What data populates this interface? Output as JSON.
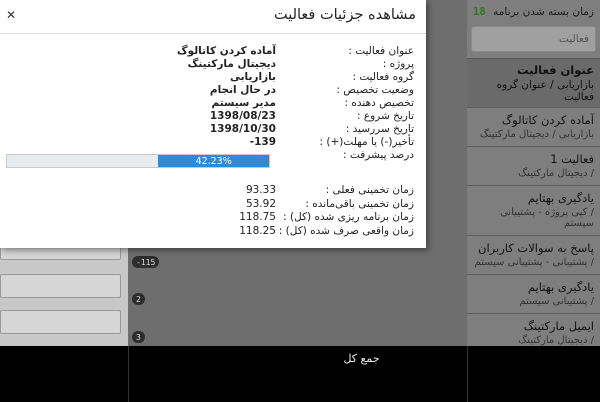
{
  "background": {
    "header_label": "زمان بسته شدن برنامه",
    "header_number": "18",
    "search_placeholder": "فعالیت",
    "column_header": {
      "title": "عنوان فعالیت",
      "subtitle": "بازاریابی / عنوان گروه فعالیت"
    },
    "items": [
      {
        "title": "آماده کردن کاتالوگ",
        "subtitle": "بازاریابی / دیجیتال مارکتینگ"
      },
      {
        "title": "فعالیت 1",
        "subtitle": "/ دیجیتال مارکتینگ"
      },
      {
        "title": "یادگیری بهتایم",
        "subtitle": "/ کپی پروژه - پشتیبانی سیستم"
      },
      {
        "title": "پاسخ به سوالات کاربران",
        "subtitle": "/ پشتیبانی - پشتیبانی سیستم"
      },
      {
        "title": "یادگیری بهتایم",
        "subtitle": "/ پشتیبانی سیستم"
      },
      {
        "title": "ایمیل مارکتینگ",
        "subtitle": "/ دیجیتال مارکتینگ"
      }
    ],
    "badges": [
      "-115",
      "2",
      "3"
    ],
    "total_label": "جمع کل"
  },
  "modal": {
    "title": "مشاهده جزئیات فعالیت",
    "close_symbol": "✕",
    "details": [
      {
        "label": "عنوان فعالیت :",
        "value": "آماده کردن کاتالوگ"
      },
      {
        "label": "پروژه :",
        "value": "دیجیتال مارکتینگ"
      },
      {
        "label": "گروه فعالیت :",
        "value": "بازاریابی"
      },
      {
        "label": "وضعیت تخصیص :",
        "value": "در حال انجام"
      },
      {
        "label": "تخصیص دهنده :",
        "value": "مدیر سیستم"
      },
      {
        "label": "تاریخ شروع :",
        "value": "1398/08/23"
      },
      {
        "label": "تاریخ سررسید :",
        "value": "1398/10/30"
      },
      {
        "label": "تأخیر(-) یا مهلت(+) :",
        "value": "-139"
      }
    ],
    "progress": {
      "label": "درصد پیشرفت :",
      "percent": 42.23,
      "text": "42.23%"
    },
    "times": [
      {
        "label": "زمان تخمینی فعلی :",
        "value": "93.33"
      },
      {
        "label": "زمان تخمینی باقی‌مانده :",
        "value": "53.92"
      },
      {
        "label": "زمان برنامه ریزی شده (کل) :",
        "value": "118.75"
      },
      {
        "label": "زمان واقعی صرف شده (کل) :",
        "value": "118.25"
      }
    ],
    "colors": {
      "progress_fill": "#2f8bd6"
    }
  }
}
